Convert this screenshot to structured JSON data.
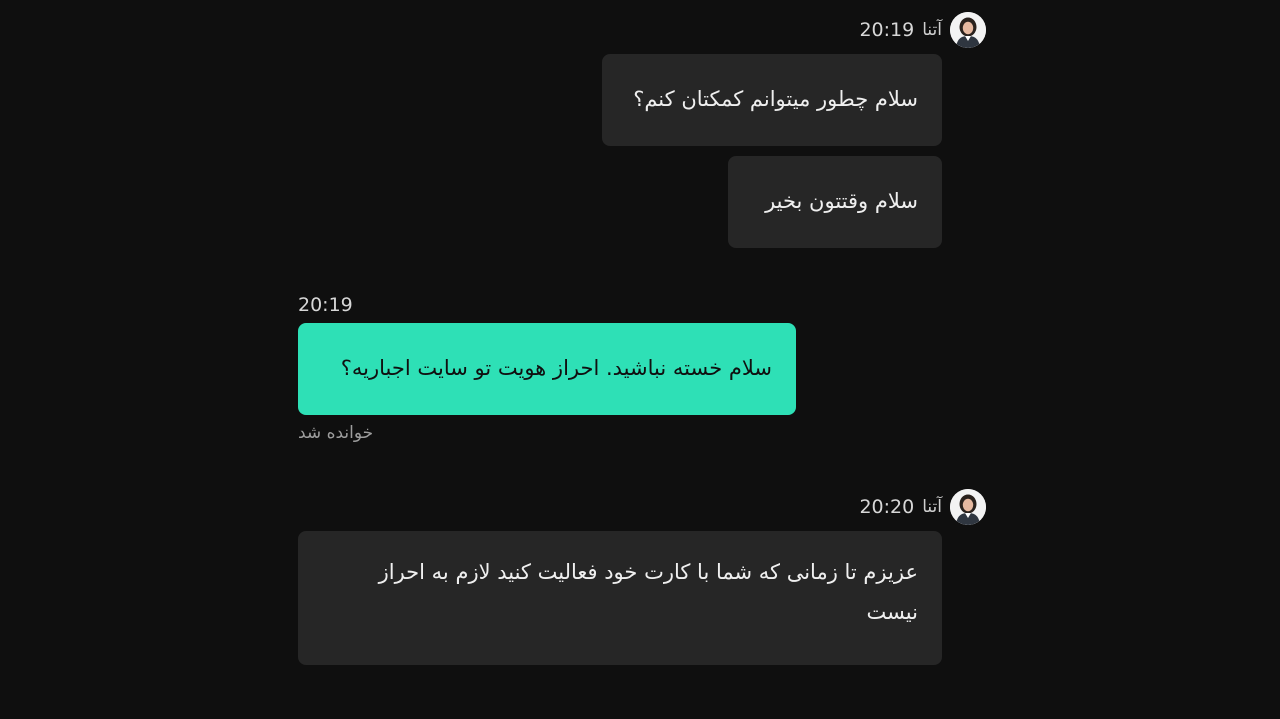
{
  "messages": {
    "group1": {
      "agent_name": "آتنا",
      "time": "20:19",
      "bubble1": "سلام چطور میتوانم کمکتان کنم؟",
      "bubble2": "سلام وقتتون بخیر"
    },
    "user_msg": {
      "time": "20:19",
      "text": "سلام خسته نباشید. احراز هویت تو سایت اجباریه؟",
      "status": "خوانده شد"
    },
    "group2": {
      "agent_name": "آتنا",
      "time": "20:20",
      "bubble1": "عزیزم تا زمانی که شما با کارت خود فعالیت کنید لازم به احراز نیست"
    }
  },
  "colors": {
    "background": "#0f0f0f",
    "agent_bubble": "#262626",
    "user_bubble": "#2ee0b6"
  },
  "icons": {
    "agent_avatar": "agent-avatar-icon"
  }
}
